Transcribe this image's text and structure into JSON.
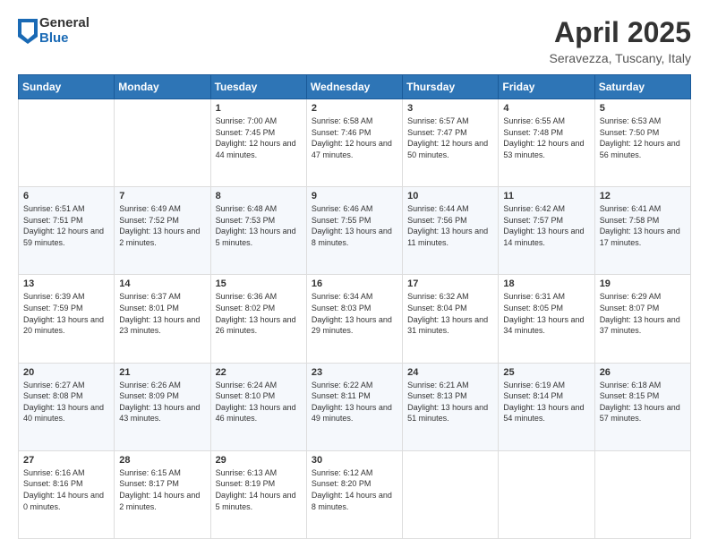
{
  "header": {
    "logo": {
      "general": "General",
      "blue": "Blue"
    },
    "title": "April 2025",
    "subtitle": "Seravezza, Tuscany, Italy"
  },
  "days_of_week": [
    "Sunday",
    "Monday",
    "Tuesday",
    "Wednesday",
    "Thursday",
    "Friday",
    "Saturday"
  ],
  "weeks": [
    [
      {
        "day": "",
        "sunrise": "",
        "sunset": "",
        "daylight": ""
      },
      {
        "day": "",
        "sunrise": "",
        "sunset": "",
        "daylight": ""
      },
      {
        "day": "1",
        "sunrise": "Sunrise: 7:00 AM",
        "sunset": "Sunset: 7:45 PM",
        "daylight": "Daylight: 12 hours and 44 minutes."
      },
      {
        "day": "2",
        "sunrise": "Sunrise: 6:58 AM",
        "sunset": "Sunset: 7:46 PM",
        "daylight": "Daylight: 12 hours and 47 minutes."
      },
      {
        "day": "3",
        "sunrise": "Sunrise: 6:57 AM",
        "sunset": "Sunset: 7:47 PM",
        "daylight": "Daylight: 12 hours and 50 minutes."
      },
      {
        "day": "4",
        "sunrise": "Sunrise: 6:55 AM",
        "sunset": "Sunset: 7:48 PM",
        "daylight": "Daylight: 12 hours and 53 minutes."
      },
      {
        "day": "5",
        "sunrise": "Sunrise: 6:53 AM",
        "sunset": "Sunset: 7:50 PM",
        "daylight": "Daylight: 12 hours and 56 minutes."
      }
    ],
    [
      {
        "day": "6",
        "sunrise": "Sunrise: 6:51 AM",
        "sunset": "Sunset: 7:51 PM",
        "daylight": "Daylight: 12 hours and 59 minutes."
      },
      {
        "day": "7",
        "sunrise": "Sunrise: 6:49 AM",
        "sunset": "Sunset: 7:52 PM",
        "daylight": "Daylight: 13 hours and 2 minutes."
      },
      {
        "day": "8",
        "sunrise": "Sunrise: 6:48 AM",
        "sunset": "Sunset: 7:53 PM",
        "daylight": "Daylight: 13 hours and 5 minutes."
      },
      {
        "day": "9",
        "sunrise": "Sunrise: 6:46 AM",
        "sunset": "Sunset: 7:55 PM",
        "daylight": "Daylight: 13 hours and 8 minutes."
      },
      {
        "day": "10",
        "sunrise": "Sunrise: 6:44 AM",
        "sunset": "Sunset: 7:56 PM",
        "daylight": "Daylight: 13 hours and 11 minutes."
      },
      {
        "day": "11",
        "sunrise": "Sunrise: 6:42 AM",
        "sunset": "Sunset: 7:57 PM",
        "daylight": "Daylight: 13 hours and 14 minutes."
      },
      {
        "day": "12",
        "sunrise": "Sunrise: 6:41 AM",
        "sunset": "Sunset: 7:58 PM",
        "daylight": "Daylight: 13 hours and 17 minutes."
      }
    ],
    [
      {
        "day": "13",
        "sunrise": "Sunrise: 6:39 AM",
        "sunset": "Sunset: 7:59 PM",
        "daylight": "Daylight: 13 hours and 20 minutes."
      },
      {
        "day": "14",
        "sunrise": "Sunrise: 6:37 AM",
        "sunset": "Sunset: 8:01 PM",
        "daylight": "Daylight: 13 hours and 23 minutes."
      },
      {
        "day": "15",
        "sunrise": "Sunrise: 6:36 AM",
        "sunset": "Sunset: 8:02 PM",
        "daylight": "Daylight: 13 hours and 26 minutes."
      },
      {
        "day": "16",
        "sunrise": "Sunrise: 6:34 AM",
        "sunset": "Sunset: 8:03 PM",
        "daylight": "Daylight: 13 hours and 29 minutes."
      },
      {
        "day": "17",
        "sunrise": "Sunrise: 6:32 AM",
        "sunset": "Sunset: 8:04 PM",
        "daylight": "Daylight: 13 hours and 31 minutes."
      },
      {
        "day": "18",
        "sunrise": "Sunrise: 6:31 AM",
        "sunset": "Sunset: 8:05 PM",
        "daylight": "Daylight: 13 hours and 34 minutes."
      },
      {
        "day": "19",
        "sunrise": "Sunrise: 6:29 AM",
        "sunset": "Sunset: 8:07 PM",
        "daylight": "Daylight: 13 hours and 37 minutes."
      }
    ],
    [
      {
        "day": "20",
        "sunrise": "Sunrise: 6:27 AM",
        "sunset": "Sunset: 8:08 PM",
        "daylight": "Daylight: 13 hours and 40 minutes."
      },
      {
        "day": "21",
        "sunrise": "Sunrise: 6:26 AM",
        "sunset": "Sunset: 8:09 PM",
        "daylight": "Daylight: 13 hours and 43 minutes."
      },
      {
        "day": "22",
        "sunrise": "Sunrise: 6:24 AM",
        "sunset": "Sunset: 8:10 PM",
        "daylight": "Daylight: 13 hours and 46 minutes."
      },
      {
        "day": "23",
        "sunrise": "Sunrise: 6:22 AM",
        "sunset": "Sunset: 8:11 PM",
        "daylight": "Daylight: 13 hours and 49 minutes."
      },
      {
        "day": "24",
        "sunrise": "Sunrise: 6:21 AM",
        "sunset": "Sunset: 8:13 PM",
        "daylight": "Daylight: 13 hours and 51 minutes."
      },
      {
        "day": "25",
        "sunrise": "Sunrise: 6:19 AM",
        "sunset": "Sunset: 8:14 PM",
        "daylight": "Daylight: 13 hours and 54 minutes."
      },
      {
        "day": "26",
        "sunrise": "Sunrise: 6:18 AM",
        "sunset": "Sunset: 8:15 PM",
        "daylight": "Daylight: 13 hours and 57 minutes."
      }
    ],
    [
      {
        "day": "27",
        "sunrise": "Sunrise: 6:16 AM",
        "sunset": "Sunset: 8:16 PM",
        "daylight": "Daylight: 14 hours and 0 minutes."
      },
      {
        "day": "28",
        "sunrise": "Sunrise: 6:15 AM",
        "sunset": "Sunset: 8:17 PM",
        "daylight": "Daylight: 14 hours and 2 minutes."
      },
      {
        "day": "29",
        "sunrise": "Sunrise: 6:13 AM",
        "sunset": "Sunset: 8:19 PM",
        "daylight": "Daylight: 14 hours and 5 minutes."
      },
      {
        "day": "30",
        "sunrise": "Sunrise: 6:12 AM",
        "sunset": "Sunset: 8:20 PM",
        "daylight": "Daylight: 14 hours and 8 minutes."
      },
      {
        "day": "",
        "sunrise": "",
        "sunset": "",
        "daylight": ""
      },
      {
        "day": "",
        "sunrise": "",
        "sunset": "",
        "daylight": ""
      },
      {
        "day": "",
        "sunrise": "",
        "sunset": "",
        "daylight": ""
      }
    ]
  ]
}
